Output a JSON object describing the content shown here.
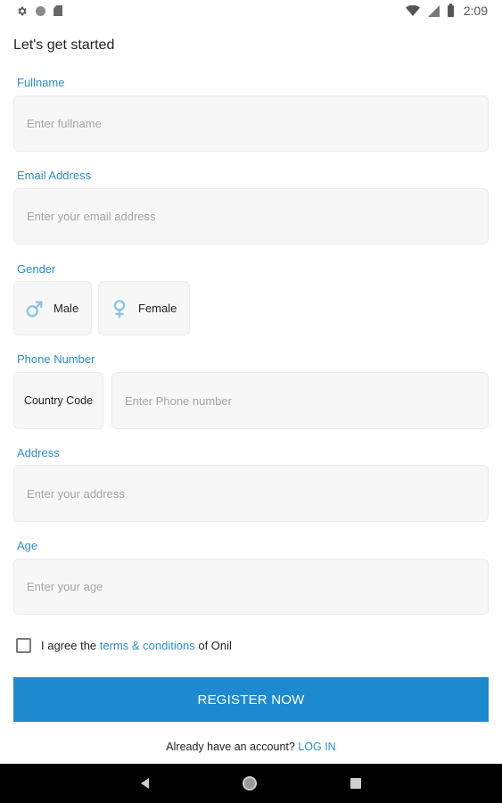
{
  "status_bar": {
    "time": "2:09",
    "icons": [
      "settings-icon",
      "circle-status-icon",
      "sd-card-icon",
      "wifi-icon",
      "signal-icon",
      "battery-icon"
    ]
  },
  "header": {
    "title": "Let's get started"
  },
  "form": {
    "fullname": {
      "label": "Fullname",
      "placeholder": "Enter fullname",
      "value": ""
    },
    "email": {
      "label": "Email Address",
      "placeholder": "Enter your email address",
      "value": ""
    },
    "gender": {
      "label": "Gender",
      "options": [
        {
          "label": "Male",
          "icon": "male-icon"
        },
        {
          "label": "Female",
          "icon": "female-icon"
        }
      ]
    },
    "phone": {
      "label": "Phone Number",
      "country_code": "Country Code",
      "placeholder": "Enter Phone number",
      "value": ""
    },
    "address": {
      "label": "Address",
      "placeholder": "Enter your address",
      "value": ""
    },
    "age": {
      "label": "Age",
      "placeholder": "Enter your age",
      "value": ""
    }
  },
  "terms": {
    "prefix": "I agree the",
    "link": "terms & conditions",
    "suffix": "of Onil",
    "checked": false
  },
  "register_button": "REGISTER NOW",
  "login": {
    "prompt": "Already have an account?",
    "link": "LOG IN"
  },
  "colors": {
    "accent": "#1d8ad0",
    "label": "#2b8ccb",
    "field_bg": "#f7f7f8",
    "gender_icon": "#8cc5e8"
  },
  "nav_bar": {
    "icons": [
      "back-icon",
      "home-icon",
      "recents-icon"
    ]
  }
}
